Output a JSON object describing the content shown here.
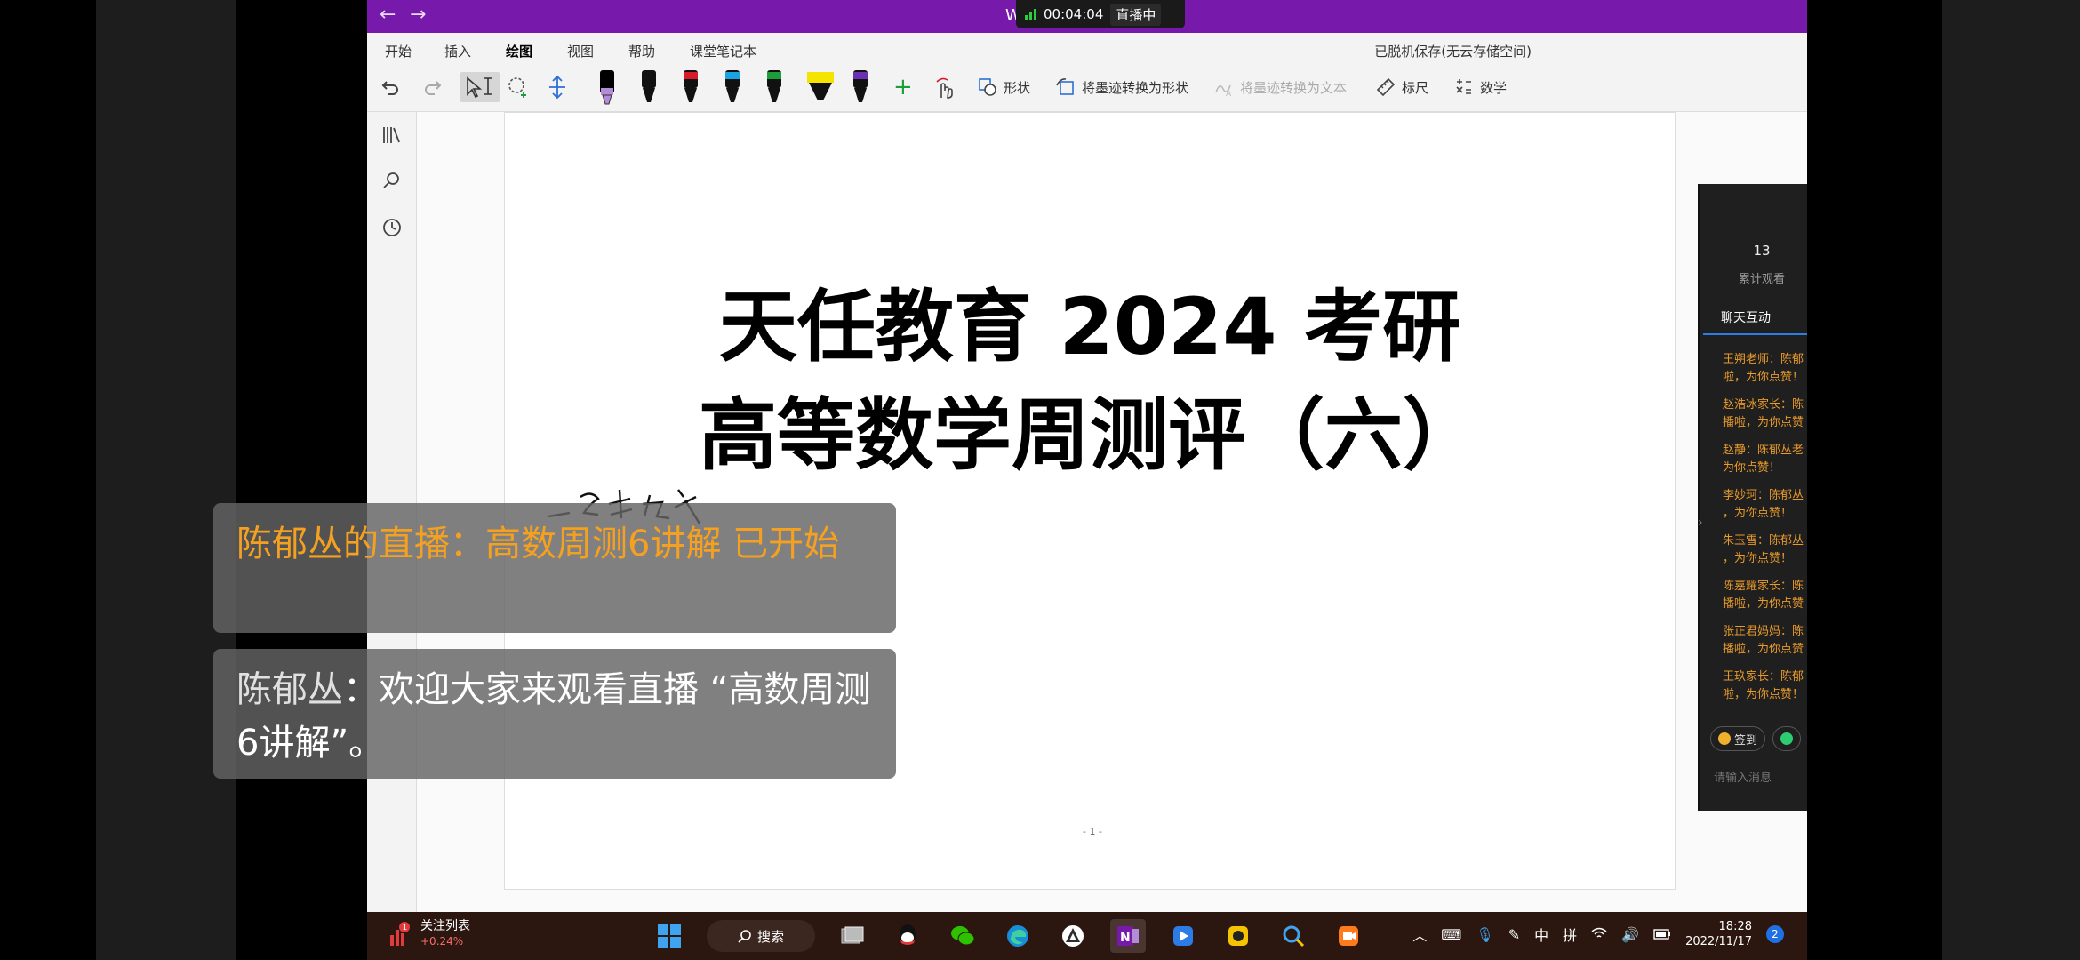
{
  "titlebar": {
    "doc_title_left": "W",
    "doc_title_right": "e",
    "timer": "00:04:04",
    "live_status": "直播中"
  },
  "ribbon": {
    "tabs": [
      "开始",
      "插入",
      "绘图",
      "视图",
      "帮助",
      "课堂笔记本"
    ],
    "active_tab": "绘图",
    "save_status": "已脱机保存(无云存储空间)"
  },
  "toolbar": {
    "shapes_label": "形状",
    "ink_to_shape_label": "将墨迹转换为形状",
    "ink_to_text_label": "将墨迹转换为文本",
    "ruler_label": "标尺",
    "math_label": "数学",
    "pen_colors": [
      "#000000",
      "#111111",
      "#d81b2a",
      "#1aa3e0",
      "#1b9e3a",
      "#f5e400",
      "#6b2fb3"
    ]
  },
  "page": {
    "title_line1": "天任教育 2024 考研",
    "title_line2": "高等数学周测评（六）",
    "page_number": "- 1 -"
  },
  "notifications": {
    "n1": "陈郁丛的直播：高数周测6讲解 已开始",
    "n2_name": "陈郁丛",
    "n2_text": "：欢迎大家来观看直播 “高数周测6讲解”。"
  },
  "live_panel": {
    "views": "13",
    "views_label": "累计观看",
    "chat_tab": "聊天互动",
    "messages": [
      "王朔老师：陈郁",
      "啦，为你点赞！",
      "赵浩冰家长：陈",
      "播啦，为你点赞",
      "赵静：陈郁丛老",
      "为你点赞！",
      "李妙珂：陈郁丛",
      "，为你点赞！",
      "朱玉雪：陈郁丛",
      "，为你点赞！",
      "陈嘉耀家长：陈",
      "播啦，为你点赞",
      "张正君妈妈：陈",
      "播啦，为你点赞",
      "王玖家长：陈郁",
      "啦，为你点赞！"
    ],
    "signin_label": "签到",
    "input_placeholder": "请输入消息"
  },
  "taskbar": {
    "stock_label": "关注列表",
    "stock_change": "+0.24%",
    "stock_badge": "1",
    "search_label": "搜索",
    "ime1": "中",
    "ime2": "拼",
    "time": "18:28",
    "date": "2022/11/17",
    "notif_count": "2"
  }
}
